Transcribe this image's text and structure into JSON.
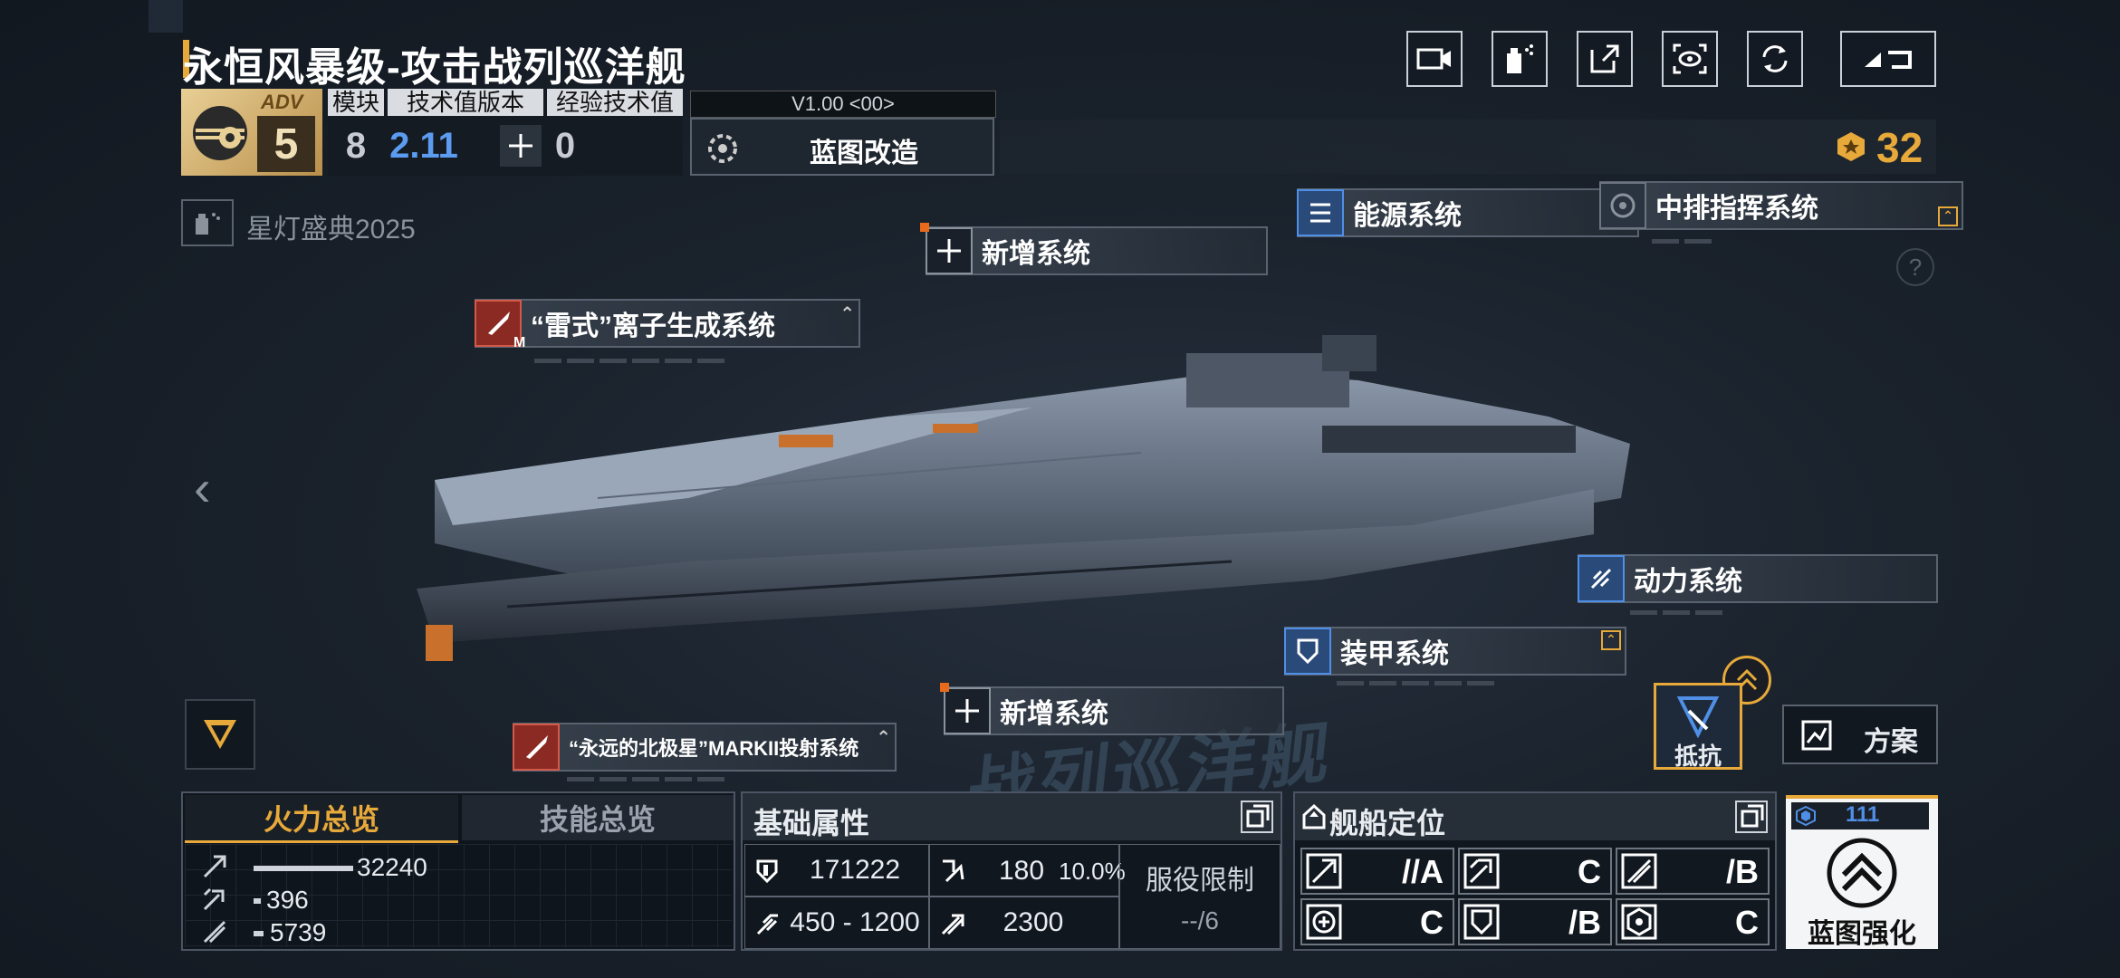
{
  "ship": {
    "name": "永恒风暴级-攻击战列巡洋舰",
    "rank_badge": "ADV",
    "rank_level": "5",
    "stats_headers": [
      "模块",
      "技术值版本",
      "经验技术值"
    ],
    "modules": "8",
    "tech_version": "2.11",
    "exp_tech": "0",
    "version_tag": "V1.00 <00>",
    "blueprint_mod": "蓝图改造",
    "currency": "32",
    "event_tag": "星灯盛典2025",
    "watermark": "战列巡洋舰"
  },
  "systems": {
    "new_top": "新增系统",
    "ion": "“雷式”离子生成系统",
    "ion_badge": "M",
    "energy": "能源系统",
    "command": "中排指挥系统",
    "power": "动力系统",
    "armor": "装甲系统",
    "new_bottom": "新增系统",
    "polaris": "“永远的北极星”MARKII投射系统"
  },
  "actions": {
    "resist": "抵抗",
    "plan": "方案",
    "enhance": "蓝图强化",
    "enhance_count": "111"
  },
  "firepower": {
    "tabs": [
      "火力总览",
      "技能总览"
    ],
    "rows": [
      {
        "value": "32240",
        "ratio": 1.0
      },
      {
        "value": "396",
        "ratio": 0.06
      },
      {
        "value": "5739",
        "ratio": 0.1
      }
    ]
  },
  "base_attrs": {
    "title": "基础属性",
    "hp": "171222",
    "evasion": "180",
    "evasion_pct": "10.0%",
    "speed": "450 - 1200",
    "warp": "2300",
    "service_label": "服役限制",
    "service_value": "--/6"
  },
  "positioning": {
    "title": "舰船定位",
    "cells": [
      {
        "grade": "//A"
      },
      {
        "grade": "C"
      },
      {
        "grade": "/B"
      },
      {
        "grade": "C"
      },
      {
        "grade": "/B"
      },
      {
        "grade": "C"
      }
    ]
  },
  "colors": {
    "accent": "#e7a93a",
    "blue": "#4f8fe6",
    "red": "#8a2a22"
  }
}
